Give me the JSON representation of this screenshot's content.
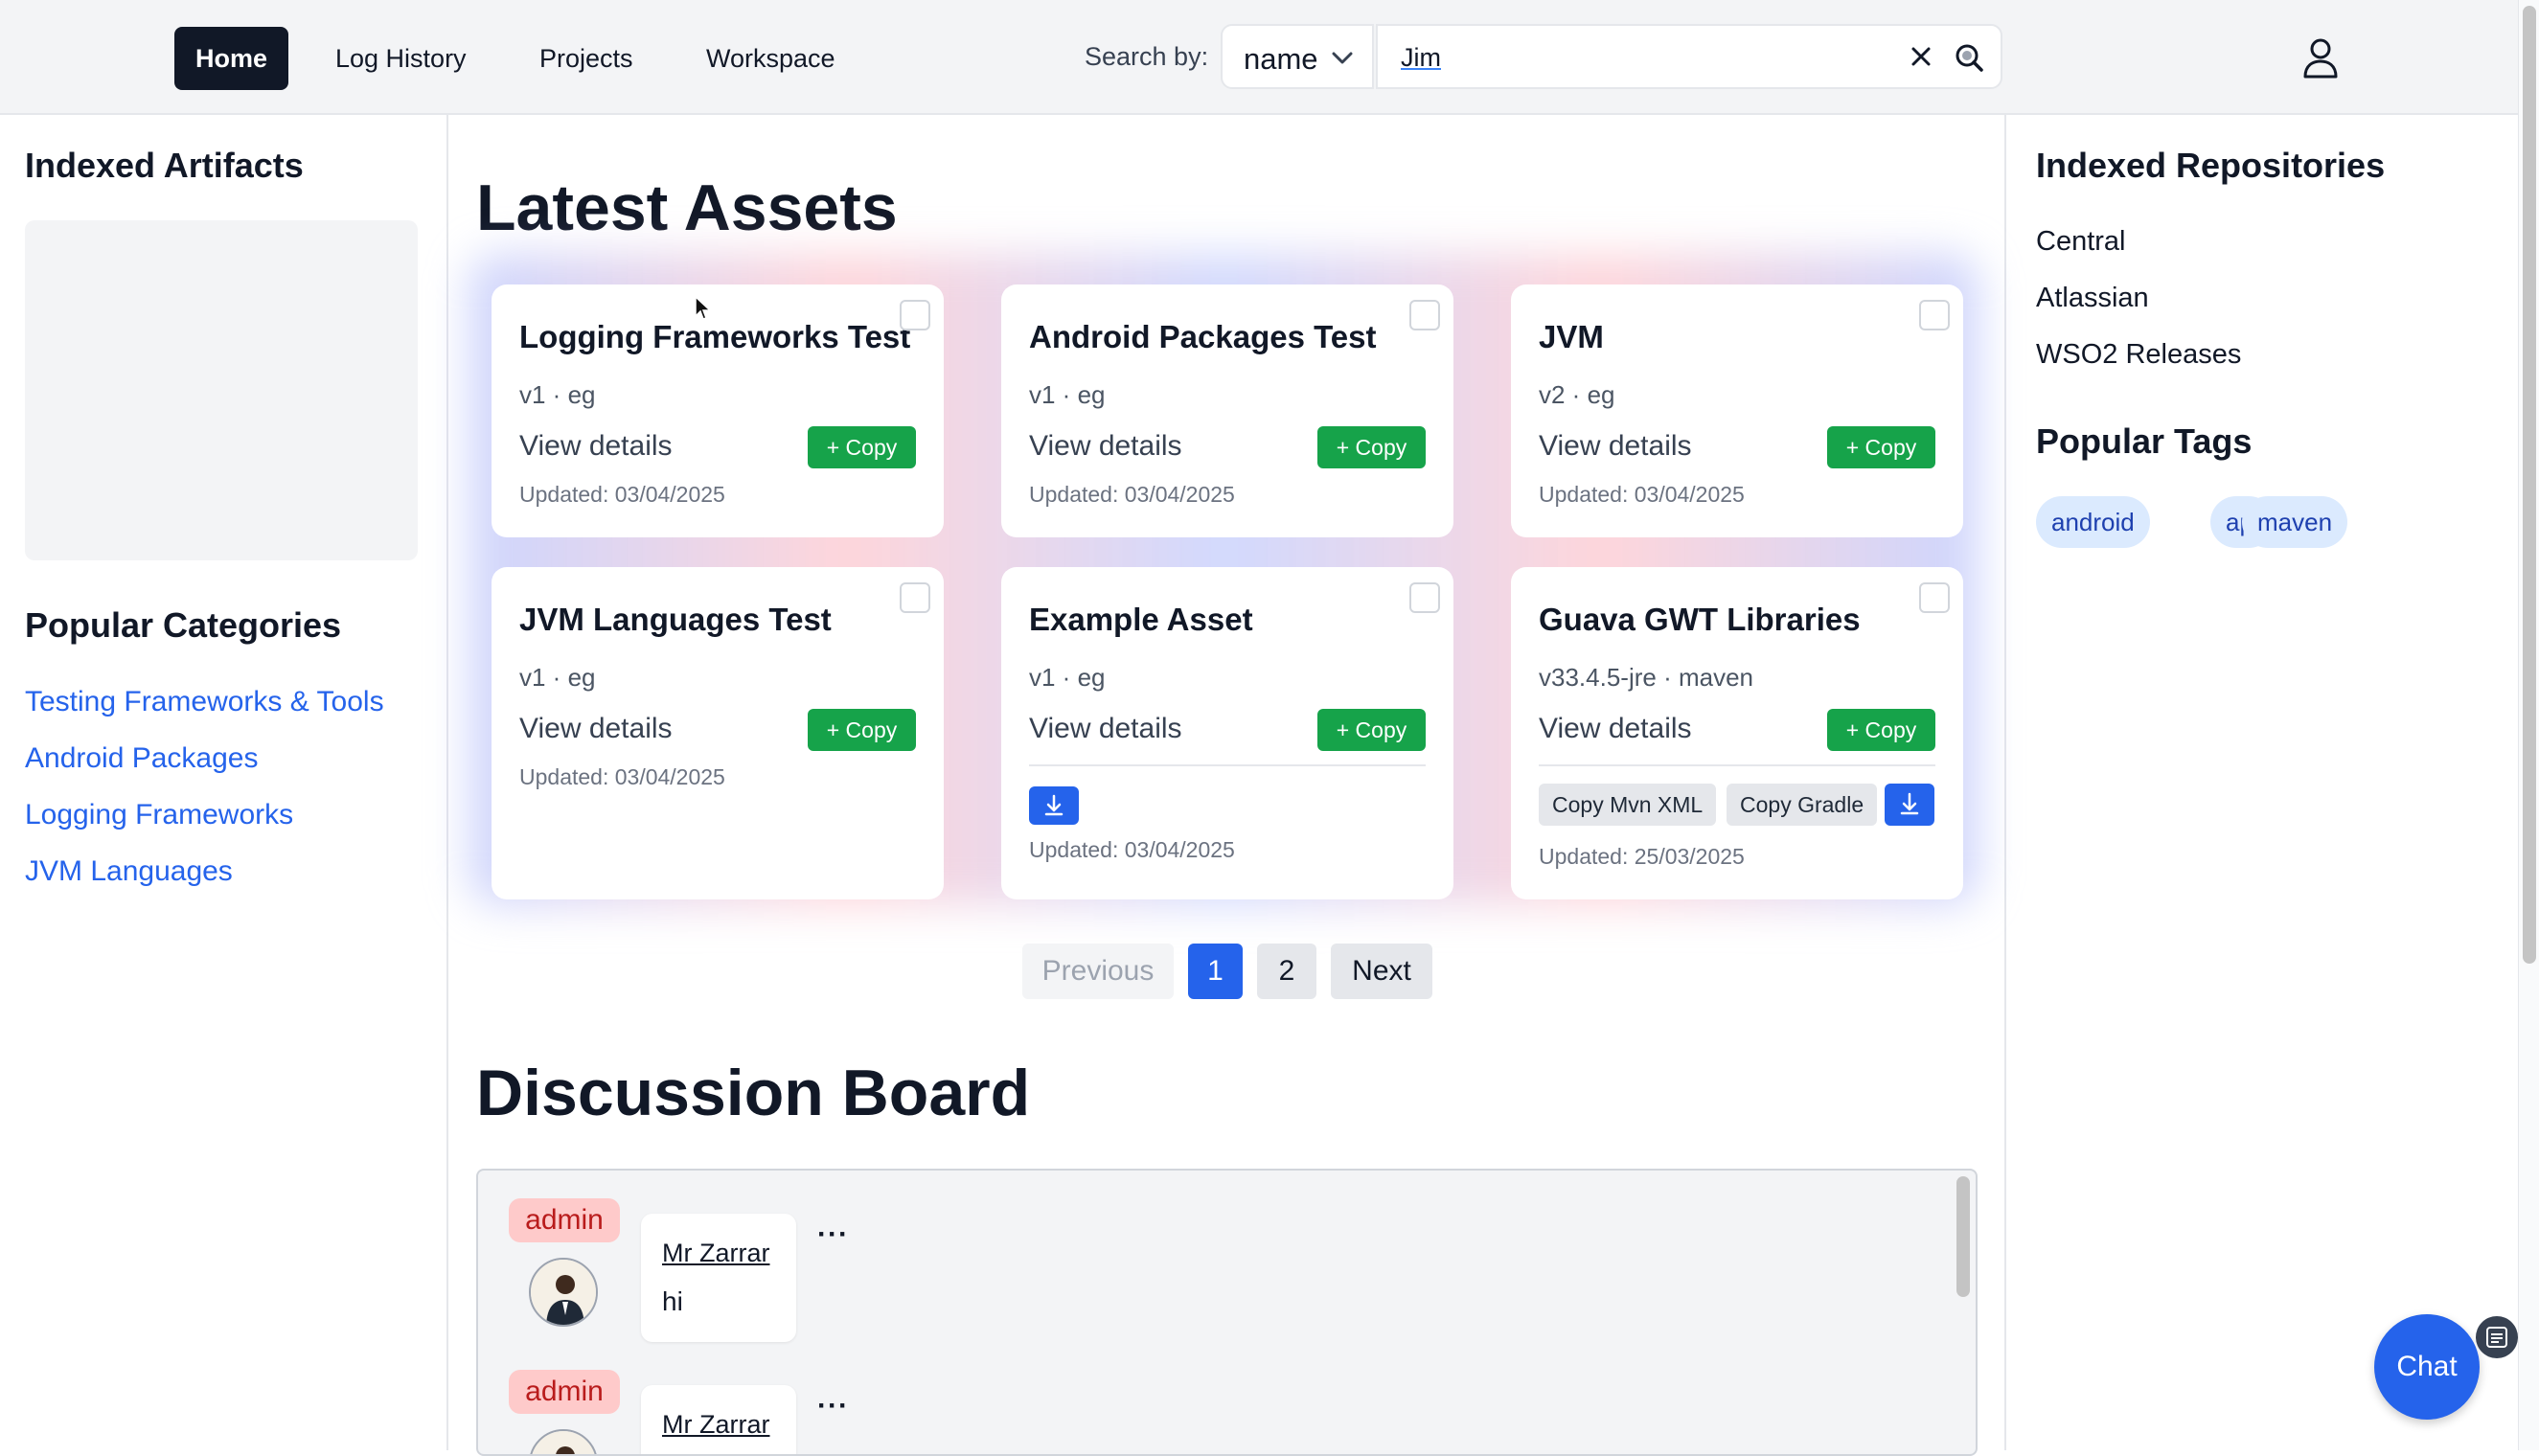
{
  "nav": {
    "items": [
      {
        "label": "Home",
        "active": true
      },
      {
        "label": "Log History",
        "active": false
      },
      {
        "label": "Projects",
        "active": false
      },
      {
        "label": "Workspace",
        "active": false
      }
    ],
    "search_by_label": "Search by:",
    "search_by_value": "name",
    "search_value": "Jim"
  },
  "left_sidebar": {
    "artifacts_heading": "Indexed Artifacts",
    "categories_heading": "Popular Categories",
    "categories": [
      "Testing Frameworks & Tools",
      "Android Packages",
      "Logging Frameworks",
      "JVM Languages"
    ]
  },
  "right_sidebar": {
    "repos_heading": "Indexed Repositories",
    "repos": [
      "Central",
      "Atlassian",
      "WSO2 Releases"
    ],
    "tags_heading": "Popular Tags",
    "tags": [
      "android",
      "api",
      "maven"
    ]
  },
  "main": {
    "assets_heading": "Latest Assets",
    "view_details_label": "View details",
    "copy_label": "+ Copy",
    "cards": [
      {
        "title": "Logging Frameworks Test",
        "meta": "v1 · eg",
        "updated": "Updated: 03/04/2025"
      },
      {
        "title": "Android Packages Test",
        "meta": "v1 · eg",
        "updated": "Updated: 03/04/2025"
      },
      {
        "title": "JVM",
        "meta": "v2 · eg",
        "updated": "Updated: 03/04/2025"
      },
      {
        "title": "JVM Languages Test",
        "meta": "v1 · eg",
        "updated": "Updated: 03/04/2025"
      },
      {
        "title": "Example Asset",
        "meta": "v1 · eg",
        "updated": "Updated: 03/04/2025"
      },
      {
        "title": "Guava GWT Libraries",
        "meta": "v33.4.5-jre · maven",
        "updated": "Updated: 25/03/2025",
        "copy_mvn_label": "Copy Mvn XML",
        "copy_gradle_label": "Copy Gradle"
      }
    ],
    "pagination": {
      "previous": "Previous",
      "pages": [
        "1",
        "2"
      ],
      "current": "1",
      "next": "Next"
    },
    "discussion_heading": "Discussion Board",
    "posts": [
      {
        "role": "admin",
        "author": "Mr Zarrar",
        "message": "hi"
      },
      {
        "role": "admin",
        "author": "Mr Zarrar",
        "message": ""
      }
    ],
    "more_label": "···"
  },
  "chat_label": "Chat",
  "colors": {
    "accent": "#2563eb",
    "copy_green": "#16a34a",
    "nav_active": "#111827",
    "admin_badge": "#fecaca"
  }
}
